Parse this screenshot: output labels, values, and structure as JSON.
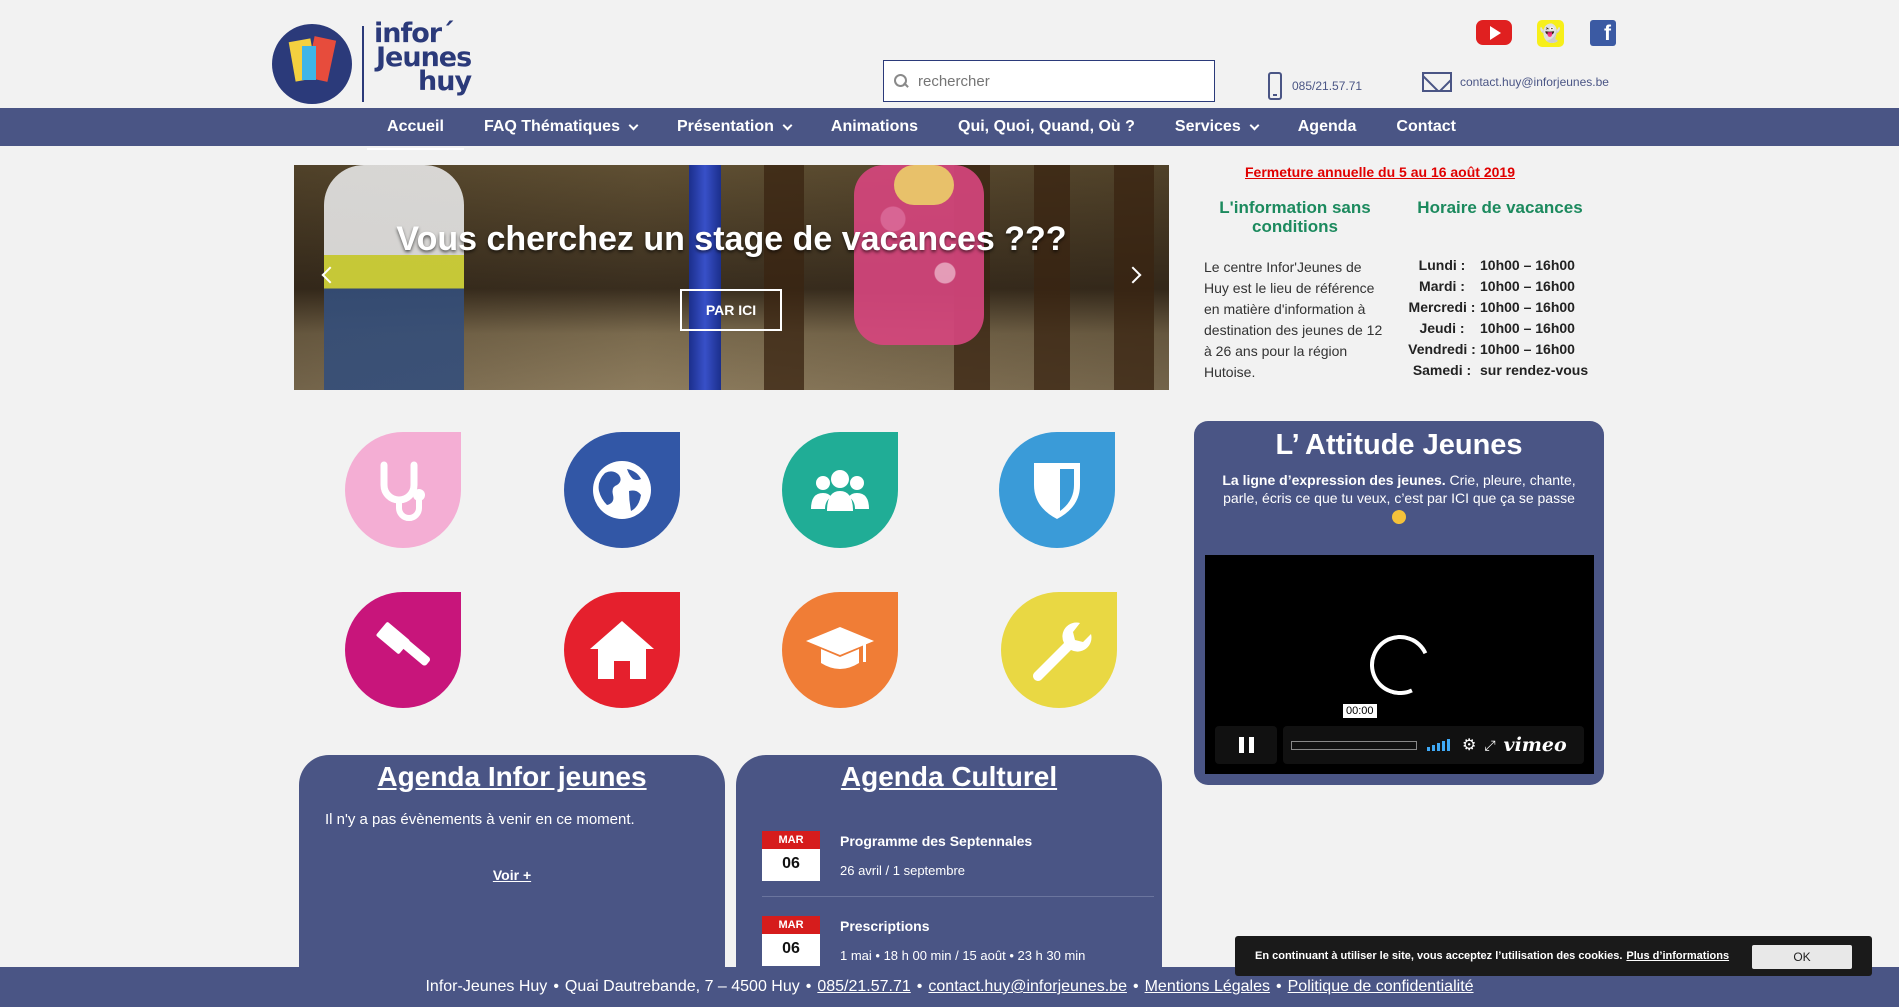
{
  "header": {
    "logo_lines": [
      "infor´",
      "Jeunes",
      "huy"
    ],
    "search_placeholder": "rechercher",
    "phone": "085/21.57.71",
    "email": "contact.huy@inforjeunes.be"
  },
  "social": [
    {
      "icon": "youtube-icon"
    },
    {
      "icon": "snapchat-icon"
    },
    {
      "icon": "facebook-icon",
      "glyph": "f"
    }
  ],
  "nav": {
    "items": [
      {
        "label": "Accueil",
        "dropdown": false,
        "active": true
      },
      {
        "label": "FAQ Thématiques",
        "dropdown": true
      },
      {
        "label": "Présentation",
        "dropdown": true
      },
      {
        "label": "Animations",
        "dropdown": false
      },
      {
        "label": "Qui, Quoi, Quand, Où ?",
        "dropdown": false
      },
      {
        "label": "Services",
        "dropdown": true
      },
      {
        "label": "Agenda",
        "dropdown": false
      },
      {
        "label": "Contact",
        "dropdown": false
      }
    ]
  },
  "hero": {
    "title": "Vous cherchez un stage de vacances ???",
    "button": "PAR ICI"
  },
  "info": {
    "closure": "Fermeture annuelle du 5 au 16 août 2019",
    "title_left": "L'information sans conditions",
    "title_right": "Horaire de vacances",
    "text": "Le centre Infor'Jeunes de Huy est le lieu de référence en matière d'information à destination des jeunes de 12 à 26 ans pour la région Hutoise.",
    "hours": [
      {
        "day": "Lundi :",
        "time": "10h00 – 16h00"
      },
      {
        "day": "Mardi :",
        "time": "10h00 – 16h00"
      },
      {
        "day": "Mercredi :",
        "time": "10h00 – 16h00"
      },
      {
        "day": "Jeudi :",
        "time": "10h00 – 16h00"
      },
      {
        "day": "Vendredi :",
        "time": "10h00 – 16h00"
      },
      {
        "day": "Samedi :",
        "time": "sur rendez-vous"
      }
    ]
  },
  "themes": [
    {
      "icon": "stethoscope-icon",
      "color": "#f4aed4"
    },
    {
      "icon": "globe-icon",
      "color": "#3257a6"
    },
    {
      "icon": "group-icon",
      "color": "#20ad96"
    },
    {
      "icon": "shield-icon",
      "color": "#3a9bd8"
    },
    {
      "icon": "gavel-icon",
      "color": "#c8157b"
    },
    {
      "icon": "house-icon",
      "color": "#e5202d"
    },
    {
      "icon": "graduation-cap-icon",
      "color": "#f07d36"
    },
    {
      "icon": "wrench-icon",
      "color": "#e9d843"
    }
  ],
  "attitude": {
    "title": "L’ Attitude Jeunes",
    "lead": "La ligne d’expression des jeunes.",
    "text": " Crie, pleure, chante, parle, écris ce que tu veux, c’est par ICI que ça se passe",
    "video_time": "00:00",
    "video_brand": "vimeo"
  },
  "agenda_infor": {
    "title": "Agenda Infor jeunes",
    "empty": "Il n'y a pas évènements à venir en ce moment.",
    "more": "Voir +"
  },
  "agenda_culturel": {
    "title": "Agenda Culturel",
    "events": [
      {
        "month": "MAR",
        "day": "06",
        "title": "Programme des Septennales",
        "sub": "26 avril / 1 septembre"
      },
      {
        "month": "MAR",
        "day": "06",
        "title": "Prescriptions",
        "sub": "1 mai • 18 h 00 min / 15 août • 23 h 30 min"
      }
    ]
  },
  "footer": {
    "org": "Infor-Jeunes Huy",
    "sep": "•",
    "address": "Quai Dautrebande, 7 – 4500 Huy",
    "phone": "085/21.57.71",
    "email": "contact.huy@inforjeunes.be",
    "legal": "Mentions Légales",
    "privacy": "Politique de confidentialité"
  },
  "cookie": {
    "text": "En continuant à utiliser le site, vous acceptez l’utilisation des cookies.",
    "more": "Plus d’informations",
    "ok": "OK"
  }
}
